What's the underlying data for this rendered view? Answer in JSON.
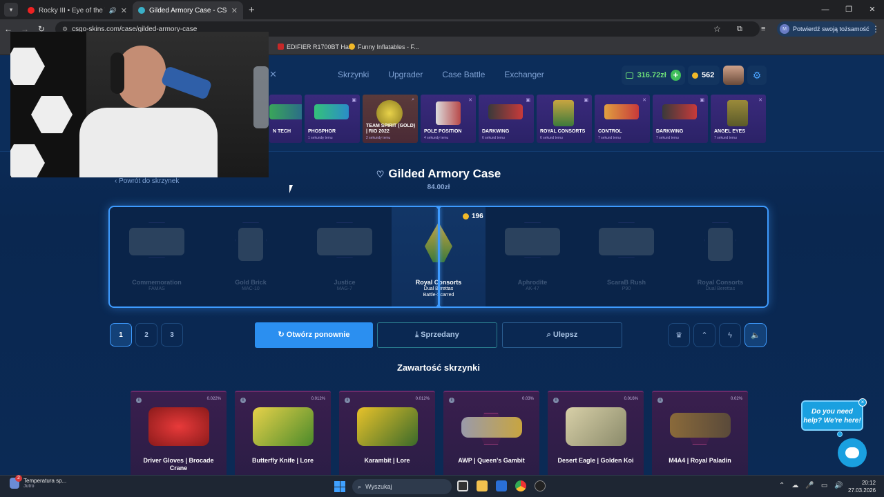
{
  "browser": {
    "tabs": [
      {
        "title": "Rocky III • Eye of the Tiger",
        "active": false
      },
      {
        "title": "Gilded Armory Case - CSGO-Sk",
        "active": true
      }
    ],
    "url": "csgo-skins.com/case/gilded-armory-case",
    "verify_label": "Potwierdź swoją tożsamość",
    "bookmarks": [
      "EDIFIER R1700BT Ha...",
      "Funny Inflatables - F..."
    ]
  },
  "site": {
    "nav": [
      "Skrzynki",
      "Upgrader",
      "Case Battle",
      "Exchanger"
    ],
    "balance": "316.72zł",
    "coins": "562",
    "live_drops": [
      {
        "name": "N TECH",
        "sub": ""
      },
      {
        "name": "PHOSPHOR",
        "sub": "1 sekundę temu"
      },
      {
        "name": "TEAM SPIRIT (GOLD) | RIO 2022",
        "sub": "2 sekundy temu"
      },
      {
        "name": "POLE POSITION",
        "sub": "4 sekundy temu"
      },
      {
        "name": "DARKWING",
        "sub": "6 sekund temu"
      },
      {
        "name": "ROYAL CONSORTS",
        "sub": "6 sekund temu"
      },
      {
        "name": "CONTROL",
        "sub": "7 sekund temu"
      },
      {
        "name": "DARKWING",
        "sub": "7 sekund temu"
      },
      {
        "name": "ANGEL EYES",
        "sub": "7 sekund temu"
      }
    ],
    "back_label": "Powrót do skrzynek",
    "case_title": "Gilded Armory Case",
    "case_price": "84.00zł",
    "reel": [
      {
        "name": "Commemoration",
        "sub": "FAMAS"
      },
      {
        "name": "Gold Brick",
        "sub": "MAC-10"
      },
      {
        "name": "Justice",
        "sub": "MAG-7"
      },
      {
        "name": "Royal Consorts",
        "sub": "Dual Berettas",
        "sub2": "Battle-Scarred"
      },
      {
        "name": "Aphrodite",
        "sub": "AK-47"
      },
      {
        "name": "ScaraB Rush",
        "sub": "P90"
      },
      {
        "name": "Royal Consorts",
        "sub": "Dual Berettas"
      }
    ],
    "win_value": "196",
    "pages": [
      "1",
      "2",
      "3"
    ],
    "btn_open": "Otwórz ponownie",
    "btn_sold": "Sprzedany",
    "btn_upgrade": "Ulepsz",
    "contents_title": "Zawartość skrzynki",
    "items": [
      {
        "name": "Driver Gloves | Brocade Crane",
        "pct": "0.022%"
      },
      {
        "name": "Butterfly Knife | Lore",
        "pct": "0.012%"
      },
      {
        "name": "Karambit | Lore",
        "pct": "0.012%"
      },
      {
        "name": "AWP | Queen's Gambit",
        "pct": "0.03%"
      },
      {
        "name": "Desert Eagle | Golden Koi",
        "pct": "0.016%"
      },
      {
        "name": "M4A4 | Royal Paladin",
        "pct": "0.02%"
      }
    ],
    "help_text": "Do you need help? We're here!"
  },
  "taskbar": {
    "weather_title": "Temperatura sp...",
    "weather_sub": "Jutro",
    "weather_badge": "2",
    "search_placeholder": "Wyszukaj",
    "time": "20:12",
    "date": "27.03.2026"
  }
}
